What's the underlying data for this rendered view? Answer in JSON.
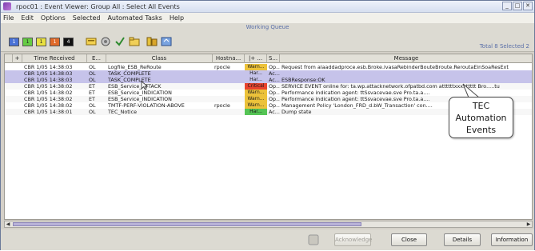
{
  "window": {
    "title": "rpoc01 : Event Viewer: Group All : Select All Events",
    "controls": {
      "minimize": "_",
      "maximize": "□",
      "close": "✕"
    }
  },
  "menu": [
    "File",
    "Edit",
    "Options",
    "Selected",
    "Automated Tasks",
    "Help"
  ],
  "toolbar": {
    "queue_label": "Working Queue",
    "severity_counts": [
      {
        "count": "1",
        "color": "#4a72d6"
      },
      {
        "count": "1",
        "color": "#66cc44"
      },
      {
        "count": "1",
        "color": "#e8e040"
      },
      {
        "count": "1",
        "color": "#e06a2a"
      },
      {
        "count": "4",
        "color": "#111111"
      }
    ],
    "totals": "Total 8   Selected 2"
  },
  "table": {
    "columns": [
      "",
      "+",
      "Time Received",
      "E...",
      "Class",
      "Hostna...",
      "|+ ...",
      "S...",
      "Message"
    ],
    "rows": [
      {
        "time": "CBR 1/05 14:38:03",
        "e": "OL",
        "cls": "Logfile_ESB_ReRoute",
        "host": "rpocle",
        "sev": "Warn...",
        "sevcolor": "#ecc23a",
        "st": "Op...",
        "msg": "Request from  alaaddadproce.esb.Broke.ivasaRebinderBouteBroute.ReroutaEinSoaResExt",
        "selected": false
      },
      {
        "time": "CBR 1/05 14:38:03",
        "e": "OL",
        "cls": "TASK_COMPLETE",
        "host": "",
        "sev": "Har...",
        "sevcolor": "",
        "st": "Ac...",
        "msg": "",
        "selected": true
      },
      {
        "time": "CBR 1/05 14:38:03",
        "e": "OL",
        "cls": "TASK_COMPLETE",
        "host": "",
        "sev": "Har...",
        "sevcolor": "",
        "st": "Ac...",
        "msg": "ESBResponse:OK",
        "selected": true
      },
      {
        "time": "CBR 1/05 14:38:02",
        "e": "ET",
        "cls": "ESB_Service_ATTACK",
        "host": "",
        "sev": "Critical",
        "sevcolor": "#e8432e",
        "st": "Op...",
        "msg": "SERVICE EVENT online for:  ta.wp.attacknetwork.ofpatbd.com  attttttxxxxttttt Bro.....tu",
        "selected": false
      },
      {
        "time": "CBR 1/05 14:38:02",
        "e": "ET",
        "cls": "ESB_Service_INDICATION",
        "host": "",
        "sev": "Warn...",
        "sevcolor": "#ecc23a",
        "st": "Op...",
        "msg": "Performance indication agent:  ttSsvacevae.sve  Pro.ta.a....",
        "selected": false
      },
      {
        "time": "CBR 1/05 14:38:02",
        "e": "ET",
        "cls": "ESB_Service_INDICATION",
        "host": "",
        "sev": "Warn...",
        "sevcolor": "#ecc23a",
        "st": "Op...",
        "msg": "Performance indication agent:  ttSsvacevae.sve  Pro.ta.a....",
        "selected": false
      },
      {
        "time": "CBR 1/05 14:38:02",
        "e": "OL",
        "cls": "TMTF-PERF-VIOLATION-ABOVE",
        "host": "rpocle",
        "sev": "Warn...",
        "sevcolor": "#ecc23a",
        "st": "Op...",
        "msg": "Management Policy 'London_FRD_d.bW_Transaction' con....",
        "selected": false
      },
      {
        "time": "CBR 1/05 14:38:01",
        "e": "OL",
        "cls": "TEC_Notice",
        "host": "",
        "sev": "Har...",
        "sevcolor": "#55c455",
        "st": "Ac...",
        "msg": "Dump state",
        "selected": false
      }
    ]
  },
  "callout": {
    "line1": "TEC",
    "line2": "Automation",
    "line3": "Events"
  },
  "buttons": {
    "acknowledge": "Acknowledge",
    "close": "Close",
    "details": "Details",
    "information": "Information"
  }
}
